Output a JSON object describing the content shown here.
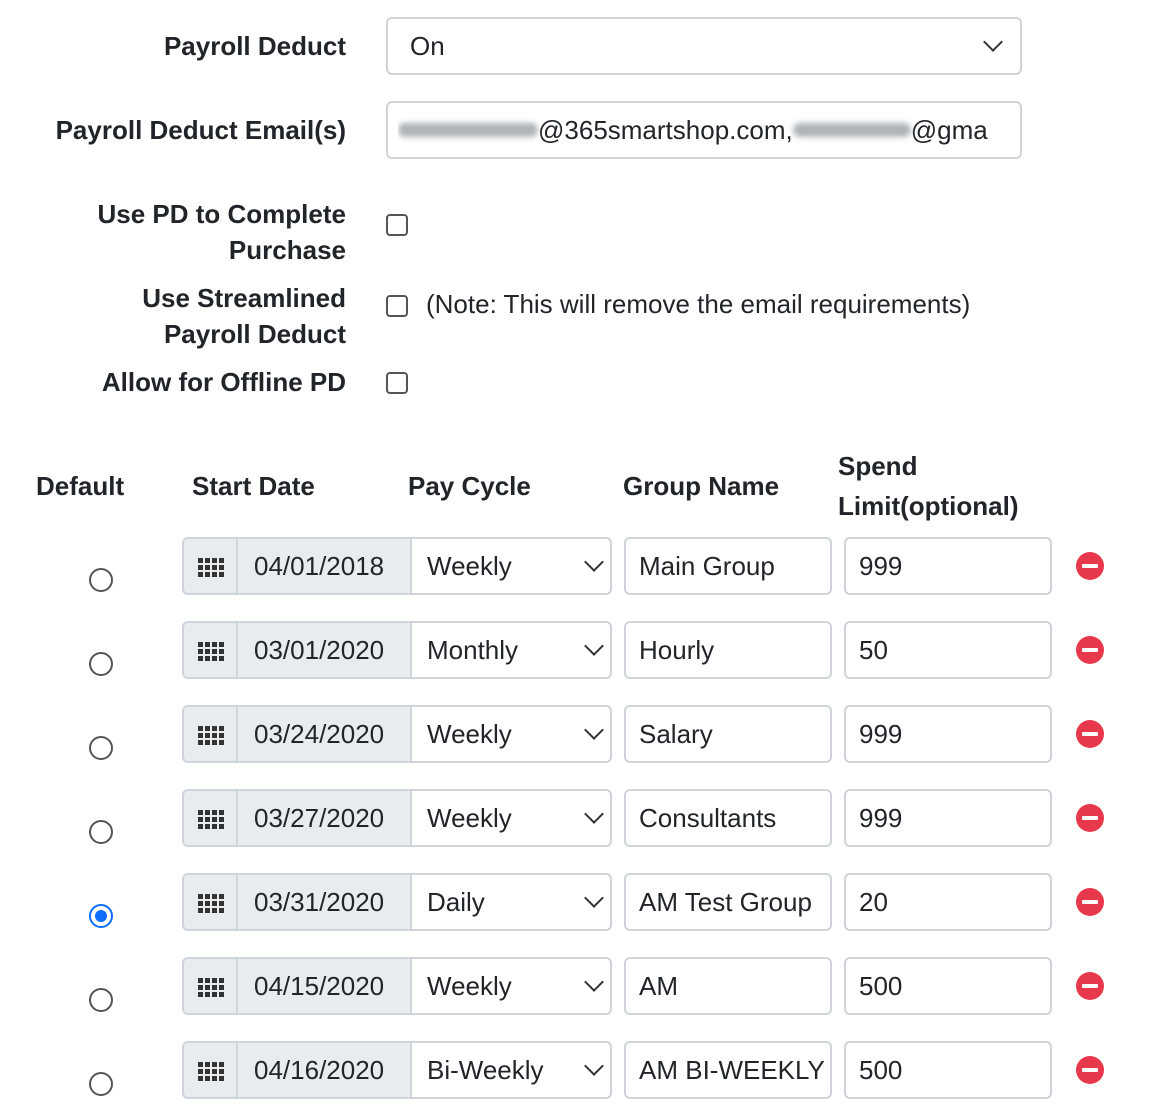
{
  "form": {
    "payroll_deduct_label": "Payroll Deduct",
    "payroll_deduct_value": "On",
    "emails_label": "Payroll Deduct Email(s)",
    "email_domain1": "@365smartshop.com,",
    "email_domain2": "@gma",
    "use_pd_label_line1": "Use PD to Complete",
    "use_pd_label_line2": "Purchase",
    "streamlined_label_line1": "Use Streamlined",
    "streamlined_label_line2": "Payroll Deduct",
    "streamlined_note": "(Note: This will remove the email requirements)",
    "offline_label": "Allow for Offline PD"
  },
  "table": {
    "headers": {
      "default": "Default",
      "start_date": "Start Date",
      "pay_cycle": "Pay Cycle",
      "group_name": "Group Name",
      "spend_limit_line1": "Spend",
      "spend_limit_line2": "Limit(optional)"
    },
    "rows": [
      {
        "selected": false,
        "date": "04/01/2018",
        "cycle": "Weekly",
        "group": "Main Group",
        "limit": "999"
      },
      {
        "selected": false,
        "date": "03/01/2020",
        "cycle": "Monthly",
        "group": "Hourly",
        "limit": "50"
      },
      {
        "selected": false,
        "date": "03/24/2020",
        "cycle": "Weekly",
        "group": "Salary",
        "limit": "999"
      },
      {
        "selected": false,
        "date": "03/27/2020",
        "cycle": "Weekly",
        "group": "Consultants",
        "limit": "999"
      },
      {
        "selected": true,
        "date": "03/31/2020",
        "cycle": "Daily",
        "group": "AM Test Group",
        "limit": "20"
      },
      {
        "selected": false,
        "date": "04/15/2020",
        "cycle": "Weekly",
        "group": "AM",
        "limit": "500"
      },
      {
        "selected": false,
        "date": "04/16/2020",
        "cycle": "Bi-Weekly",
        "group": "AM BI-WEEKLY",
        "limit": "500"
      }
    ]
  },
  "icons": {
    "calendar": "calendar-grid-icon",
    "remove": "remove-circle-icon",
    "dropdown": "chevron-down-icon"
  },
  "colors": {
    "accent": "#0d6efd",
    "remove": "#e8394c",
    "border": "#ced4da",
    "addon_bg": "#e9ecef"
  }
}
